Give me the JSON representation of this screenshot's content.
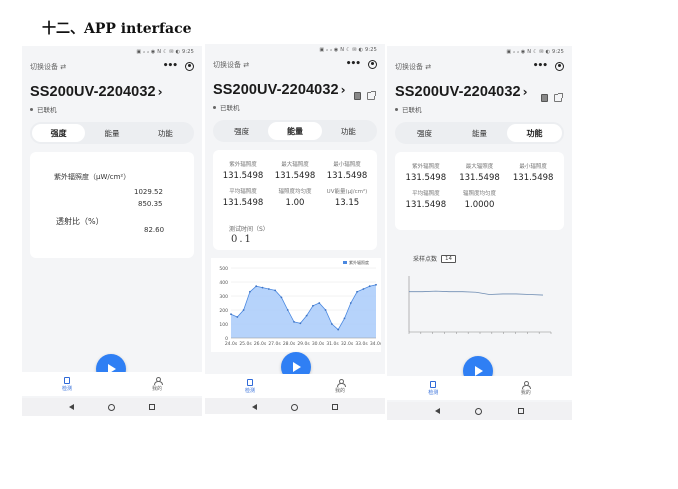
{
  "heading": "十二、APP interface",
  "status_bar": "▣ ᵢₗ ᵢₗ ◉ N ☾ ✉ ◐ 9:25",
  "switch_device": "切换设备 ⇄",
  "device_name": "SS200UV-2204032",
  "connection_status": "已联机",
  "tabs": [
    "强度",
    "能量",
    "功能"
  ],
  "phone1": {
    "active_tab": 0,
    "uv_irradiance_label": "紫外辐照度（μW/cm²）",
    "uv_values": [
      "1029.52",
      "850.35"
    ],
    "transmittance_label": "透射比（%）",
    "transmittance_value": "82.60"
  },
  "phone2": {
    "active_tab": 1,
    "metrics": [
      {
        "label": "紫外辐照度",
        "value": "131.5498"
      },
      {
        "label": "最大辐照度",
        "value": "131.5498"
      },
      {
        "label": "最小辐照度",
        "value": "131.5498"
      },
      {
        "label": "平均辐照度",
        "value": "131.5498"
      },
      {
        "label": "辐照度均匀度",
        "value": "1.00"
      },
      {
        "label": "UV能量(μJ/cm²)",
        "value": "13.15"
      }
    ],
    "test_time_label": "测试时间（S）",
    "test_time_value": "0.1",
    "legend_label": "紫外辐照度"
  },
  "phone3": {
    "active_tab": 2,
    "metrics": [
      {
        "label": "紫外辐照度",
        "value": "131.5498"
      },
      {
        "label": "最大辐照度",
        "value": "131.5498"
      },
      {
        "label": "最小辐照度",
        "value": "131.5498"
      },
      {
        "label": "平均辐照度",
        "value": "131.5498"
      },
      {
        "label": "辐照度均匀度",
        "value": "1.0000"
      }
    ],
    "sample_points_label": "采样点数",
    "sample_points_value": "14"
  },
  "bottom_nav": [
    {
      "label": "检测",
      "icon": "document-icon"
    },
    {
      "label": "我的",
      "icon": "user-icon"
    }
  ],
  "colors": {
    "accent": "#2f7ff4",
    "chart_fill": "#a9cbfa",
    "chart_line": "#4a88e0",
    "chart3_line": "#6f8db3"
  },
  "chart_data": [
    {
      "type": "area",
      "title": "",
      "legend": [
        "紫外辐照度"
      ],
      "x": [
        "24.0s",
        "25.0s",
        "26.0s",
        "27.0s",
        "28.0s",
        "29.0s",
        "30.0s",
        "31.0s",
        "32.0s",
        "33.0s",
        "34.0s"
      ],
      "series": [
        {
          "name": "紫外辐照度",
          "values": [
            170,
            150,
            200,
            330,
            370,
            360,
            350,
            340,
            290,
            200,
            115,
            105,
            160,
            230,
            250,
            200,
            100,
            60,
            140,
            250,
            330,
            350,
            370,
            380
          ]
        }
      ],
      "ylim": [
        0,
        500
      ],
      "yticks": [
        0,
        100,
        200,
        300,
        400,
        500
      ],
      "grid": true,
      "legend_position": "top-right"
    },
    {
      "type": "line",
      "title": "",
      "series": [
        {
          "values": [
            0.72,
            0.72,
            0.73,
            0.72,
            0.72,
            0.71,
            0.67,
            0.68,
            0.68,
            0.67,
            0.66
          ]
        }
      ],
      "ylim": [
        0,
        1
      ],
      "grid": false
    }
  ]
}
